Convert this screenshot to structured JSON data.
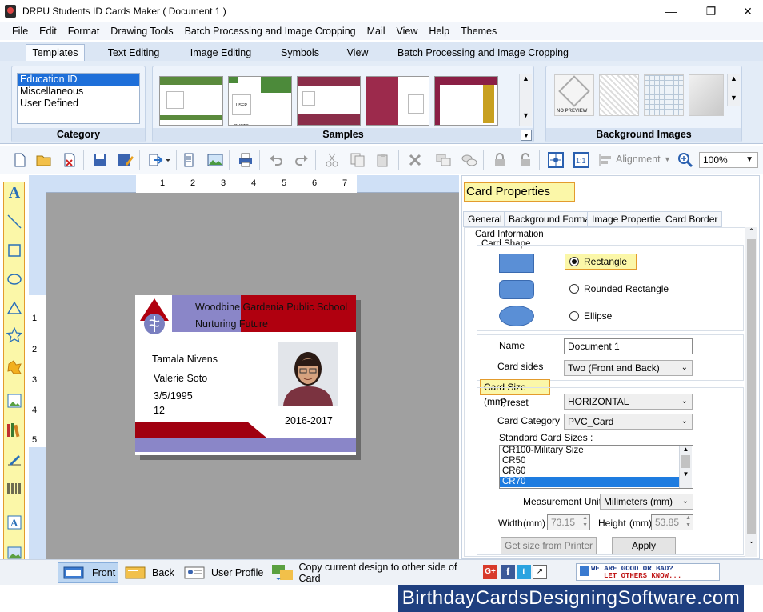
{
  "window": {
    "title": "DRPU Students ID Cards Maker ( Document 1 )",
    "minimize_glyph": "—",
    "restore_glyph": "❐",
    "close_glyph": "✕"
  },
  "menu": [
    "File",
    "Edit",
    "Format",
    "Drawing Tools",
    "Batch Processing and Image Cropping",
    "Mail",
    "View",
    "Help",
    "Themes"
  ],
  "ribbon": {
    "tabs": [
      "Templates",
      "Text Editing",
      "Image Editing",
      "Symbols",
      "View",
      "Batch Processing and Image Cropping"
    ],
    "active_tab": "Templates",
    "category": {
      "label": "Category",
      "items": [
        "Education ID",
        "Miscellaneous",
        "User Defined"
      ],
      "selected": "Education ID"
    },
    "samples": {
      "label": "Samples",
      "colors": [
        "#5a8a3c",
        "#4c8a3a",
        "#8b2e4a",
        "#9c2a4c",
        "#8a1f45"
      ],
      "sample_text": "USER PHOTO"
    },
    "background_images": {
      "label": "Background Images",
      "no_preview": "NO PREVIEW"
    }
  },
  "toolbar": {
    "alignment_label": "Alignment",
    "zoom_value": "100%"
  },
  "ruler": {
    "h_numbers": [
      "1",
      "2",
      "3",
      "4",
      "5",
      "6",
      "7"
    ],
    "v_numbers": [
      "1",
      "2",
      "3",
      "4",
      "5"
    ]
  },
  "card": {
    "school": "Woodbine Gardenia Public School",
    "motto": "Nurturing Future",
    "name1": "Tamala Nivens",
    "name2": "Valerie Soto",
    "dob": "3/5/1995",
    "grade": "12",
    "session": "2016-2017",
    "colors": {
      "header_red": "#b0000f",
      "header_purple": "#8a86c8",
      "bottom_red": "#a00010",
      "bottom_purple": "#8a86c8"
    }
  },
  "properties": {
    "title": "Card Properties",
    "tabs": [
      "General",
      "Background Format",
      "Image Properties",
      "Card Border"
    ],
    "active_tab": "General",
    "card_information_label": "Card Information",
    "card_shape_label": "Card Shape",
    "shapes": [
      {
        "label": "Rectangle",
        "selected": true
      },
      {
        "label": "Rounded Rectangle",
        "selected": false
      },
      {
        "label": "Ellipse",
        "selected": false
      }
    ],
    "name_label": "Name",
    "name_value": "Document 1",
    "card_sides_label": "Card sides",
    "card_sides_value": "Two (Front and Back)",
    "card_size_label": "Card Size (mm)",
    "preset_label": "Preset",
    "preset_value": "HORIZONTAL",
    "category_label": "Card Category",
    "category_value": "PVC_Card",
    "standard_sizes_label": "Standard Card Sizes :",
    "standard_sizes": [
      "CR100-Military Size",
      "CR50",
      "CR60",
      "CR70"
    ],
    "standard_selected": "CR70",
    "measurement_label": "Measurement Unit :",
    "measurement_value": "Milimeters (mm)",
    "width_label": "Width",
    "height_label": "Height",
    "unit_label": "(mm)",
    "width_value": "73.15",
    "height_value": "53.85",
    "get_size_button": "Get size from Printer",
    "apply_button": "Apply"
  },
  "bottom": {
    "front": "Front",
    "back": "Back",
    "user_profile": "User Profile",
    "copy_design": "Copy current design to other side of Card",
    "feedback_line1": "WE ARE GOOD OR BAD?",
    "feedback_line2": "LET OTHERS KNOW..."
  },
  "banner": "BirthdayCardsDesigningSoftware.com"
}
